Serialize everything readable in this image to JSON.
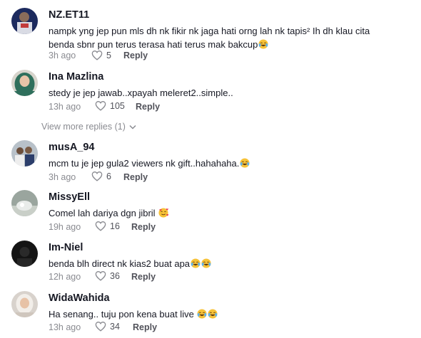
{
  "colors": {
    "text": "#161823",
    "muted": "#8a8b91",
    "action": "#51525a",
    "background": "#ffffff"
  },
  "comments": [
    {
      "username": "NZ.ET11",
      "text_line1": "nampk yng jep pun mls dh nk fikir nk jaga hati orng lah nk tapis² Ih dh klau cita",
      "text_line2": "benda sbnr pun terus terasa hati terus mak bakcup",
      "time": "3h ago",
      "likes": "5",
      "reply": "Reply"
    },
    {
      "username": "Ina Mazlina",
      "text": "stedy je jep jawab..xpayah meleret2..simple..",
      "time": "13h ago",
      "likes": "105",
      "reply": "Reply"
    },
    {
      "username": "musA_94",
      "text": "mcm tu je jep gula2 viewers nk gift..hahahaha.",
      "time": "3h ago",
      "likes": "6",
      "reply": "Reply"
    },
    {
      "username": "MissyEll",
      "text": "Comel lah dariya dgn jibril",
      "time": "19h ago",
      "likes": "16",
      "reply": "Reply"
    },
    {
      "username": "Im-Niel",
      "text": "benda blh direct nk kias2 buat apa",
      "time": "12h ago",
      "likes": "36",
      "reply": "Reply"
    },
    {
      "username": "WidaWahida",
      "text": "Ha senang.. tuju pon kena buat live",
      "time": "13h ago",
      "likes": "34",
      "reply": "Reply"
    }
  ],
  "view_more_replies": "View more replies (1)",
  "icons": {
    "like": "heart-outline-icon",
    "expand": "chevron-down-icon",
    "laugh": "face-with-tears-of-joy-emoji",
    "love": "smiling-face-with-hearts-emoji"
  }
}
